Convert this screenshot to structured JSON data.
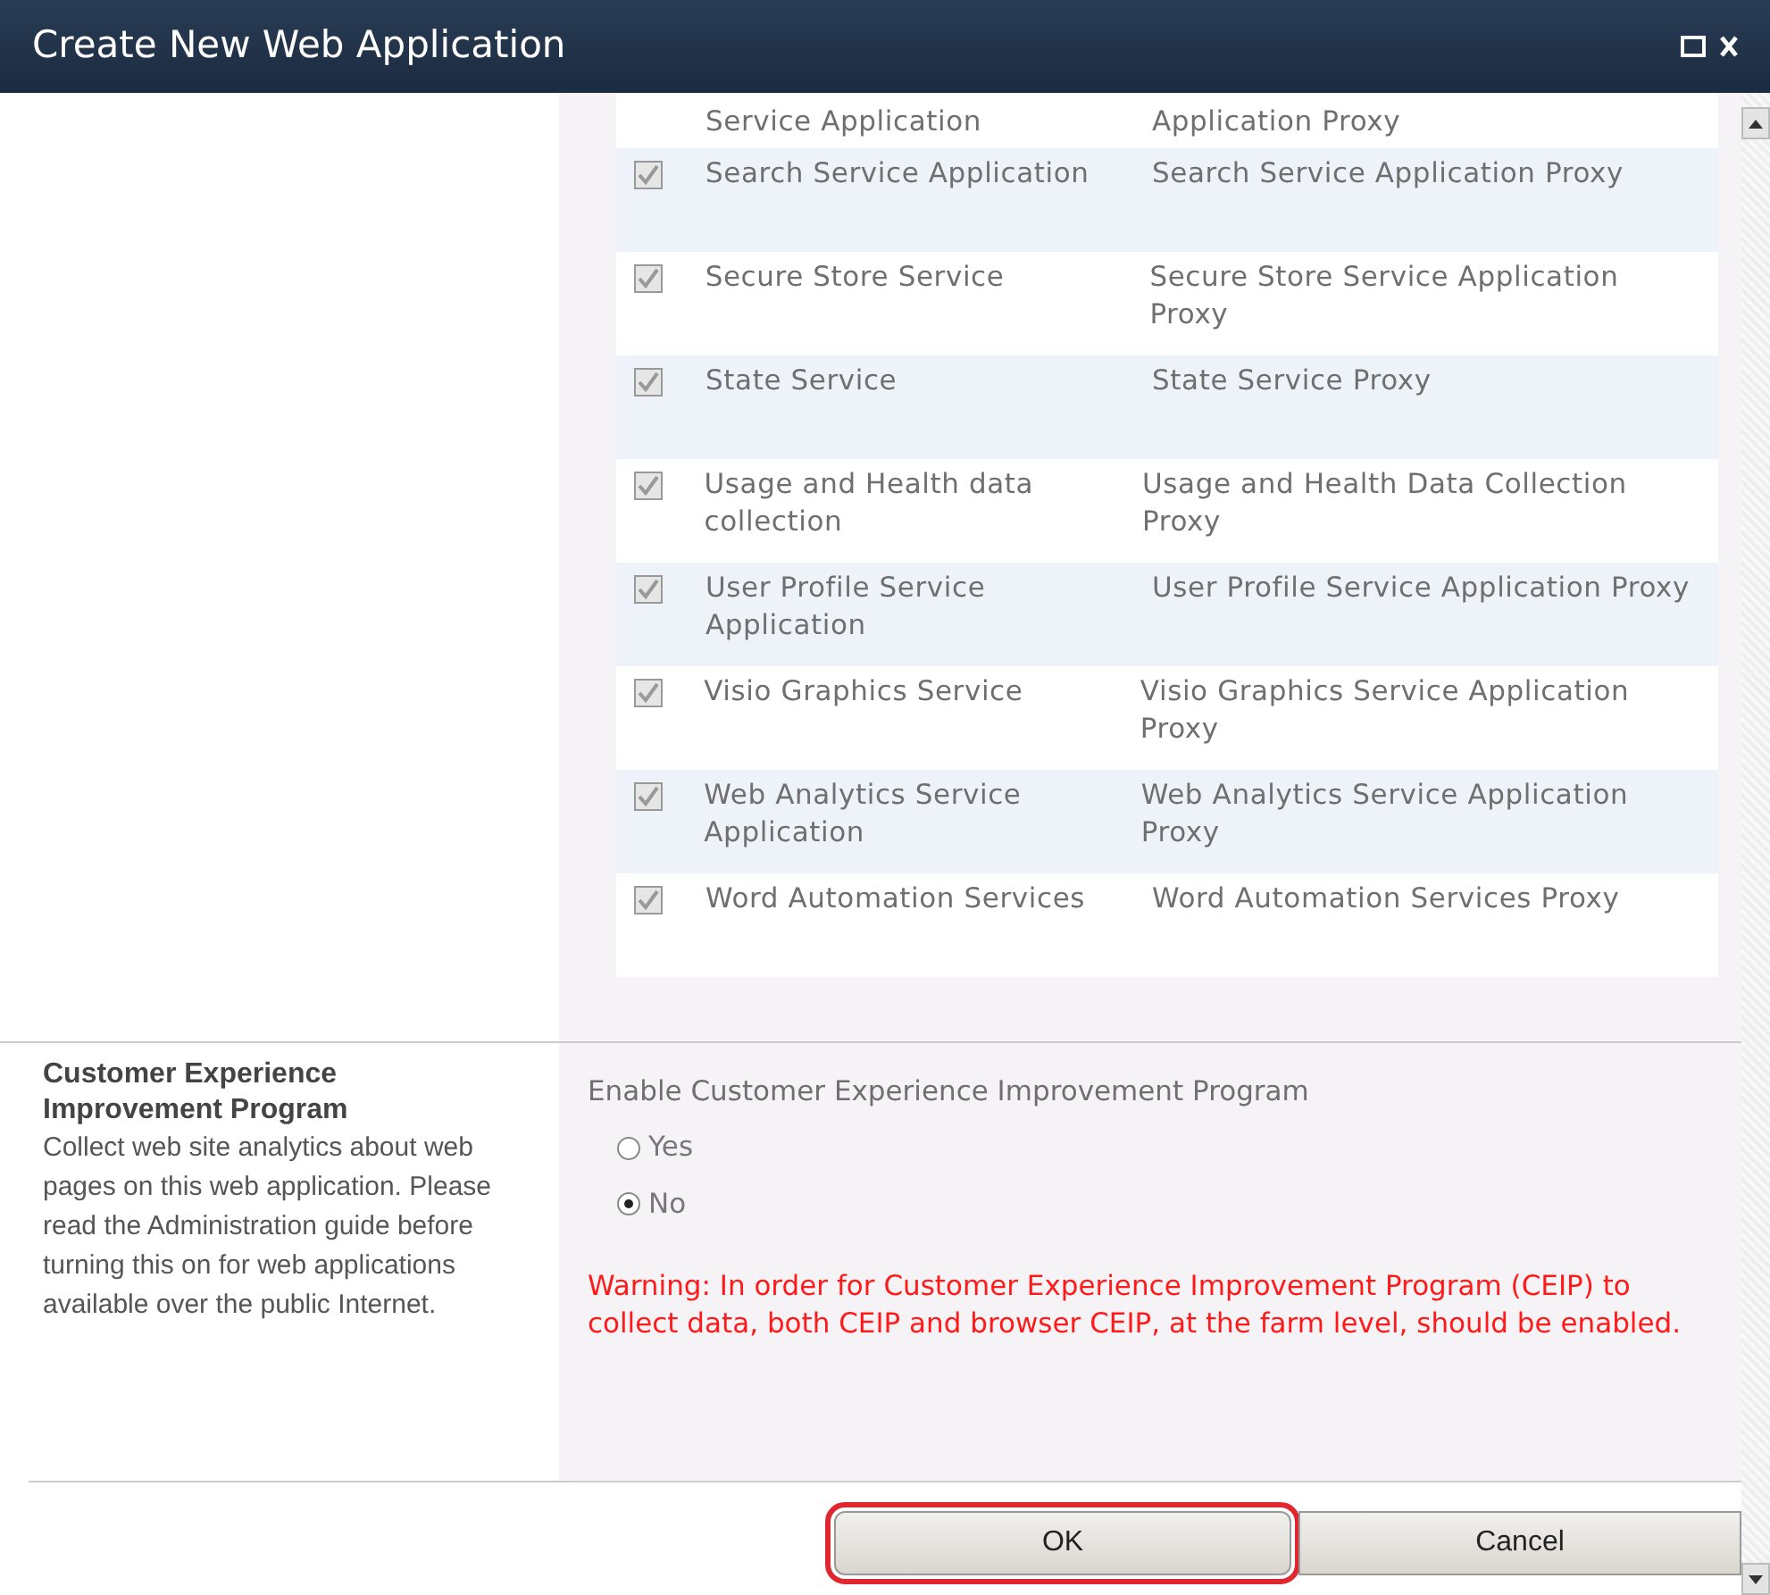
{
  "window": {
    "title": "Create New Web Application"
  },
  "services": [
    {
      "service": "Service Application",
      "proxy": "Application Proxy"
    },
    {
      "service": "Search Service Application",
      "proxy": "Search Service Application Proxy",
      "checked": true,
      "disabled": true
    },
    {
      "service": "Secure Store Service",
      "proxy": "Secure Store Service Application Proxy",
      "checked": true,
      "disabled": true
    },
    {
      "service": "State Service",
      "proxy": "State Service Proxy",
      "checked": true,
      "disabled": true
    },
    {
      "service": "Usage and Health data collection",
      "proxy": "Usage and Health Data Collection Proxy",
      "checked": true,
      "disabled": true
    },
    {
      "service": "User Profile Service Application",
      "proxy": "User Profile Service Application Proxy",
      "checked": true,
      "disabled": true
    },
    {
      "service": "Visio Graphics Service",
      "proxy": "Visio Graphics Service Application Proxy",
      "checked": true,
      "disabled": true
    },
    {
      "service": "Web Analytics Service Application",
      "proxy": "Web Analytics Service Application Proxy",
      "checked": true,
      "disabled": true
    },
    {
      "service": "Word Automation Services",
      "proxy": "Word Automation Services Proxy",
      "checked": true,
      "disabled": true
    }
  ],
  "ceip": {
    "heading": "Customer Experience Improvement Program",
    "description": "Collect web site analytics about web pages on this web application. Please read the Administration guide before turning this on for web applications available over the public Internet.",
    "label": "Enable Customer Experience Improvement Program",
    "options": [
      {
        "label": "Yes",
        "selected": false
      },
      {
        "label": "No",
        "selected": true
      }
    ],
    "warning": "Warning: In order for Customer Experience Improvement Program (CEIP) to collect data, both CEIP and browser CEIP, at the farm level, should be enabled."
  },
  "buttons": [
    {
      "label": "OK",
      "highlighted": true
    },
    {
      "label": "Cancel",
      "highlighted": false
    }
  ]
}
